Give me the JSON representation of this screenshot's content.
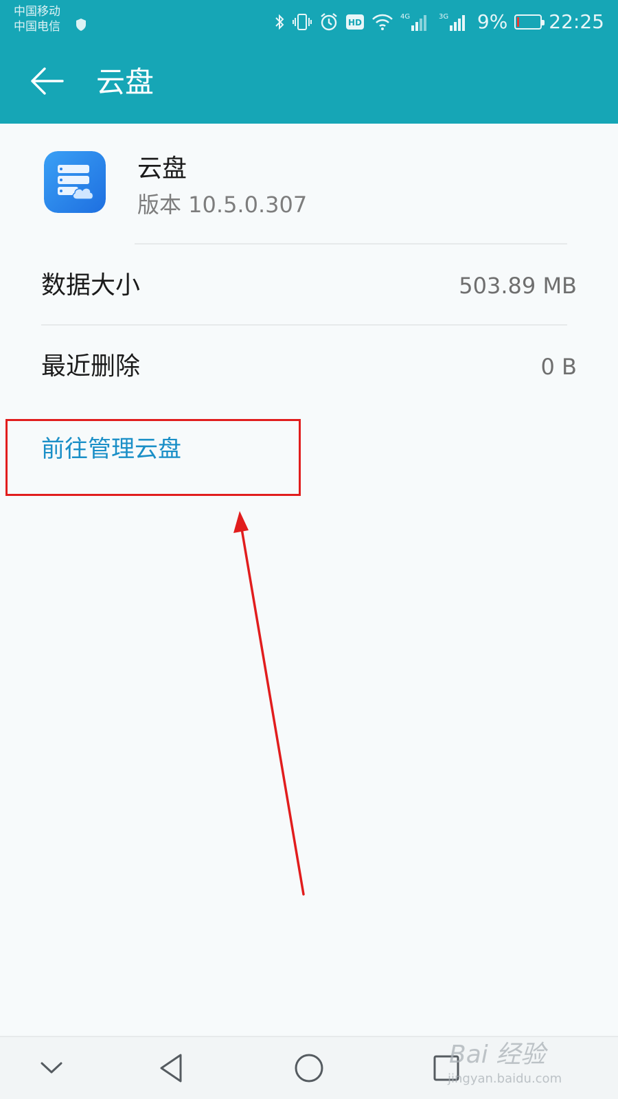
{
  "status_bar": {
    "carrier_1": "中国移动",
    "carrier_2": "中国电信",
    "net_1": "4G",
    "net_2": "3G",
    "battery_percent": "9%",
    "battery_level": 0.09,
    "time": "22:25",
    "hd_label": "HD"
  },
  "app_bar": {
    "title": "云盘"
  },
  "app_info": {
    "name": "云盘",
    "version": "版本 10.5.0.307"
  },
  "rows": [
    {
      "label": "数据大小",
      "value": "503.89 MB"
    },
    {
      "label": "最近删除",
      "value": "0 B"
    }
  ],
  "action": {
    "label": "前往管理云盘"
  },
  "watermark": {
    "brand": "Bai 经验",
    "url": "jingyan.baidu.com"
  },
  "colors": {
    "header": "#16a6b6",
    "link": "#1a8fc7",
    "annotation": "#e11d1d"
  }
}
